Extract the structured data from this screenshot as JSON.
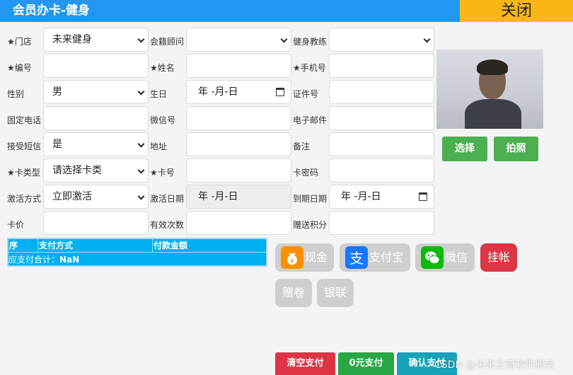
{
  "header": {
    "title": "会员办卡-健身",
    "close_label": "关闭"
  },
  "form": {
    "col1": [
      {
        "label": "★门店",
        "value": "未来健身"
      },
      {
        "label": "★编号",
        "value": ""
      },
      {
        "label": "性别",
        "value": "男"
      },
      {
        "label": "固定电话",
        "value": ""
      },
      {
        "label": "接受短信",
        "value": "是"
      },
      {
        "label": "★卡类型",
        "value": "请选择卡类"
      },
      {
        "label": "激活方式",
        "value": "立即激活"
      },
      {
        "label": "卡价",
        "value": ""
      }
    ],
    "col2": [
      {
        "label": "会籍顾问",
        "value": ""
      },
      {
        "label": "★姓名",
        "value": ""
      },
      {
        "label": "生日",
        "value": "年 -月-日"
      },
      {
        "label": "微信号",
        "value": ""
      },
      {
        "label": "地址",
        "value": ""
      },
      {
        "label": "★卡号",
        "value": ""
      },
      {
        "label": "激活日期",
        "value": "年 -月-日"
      },
      {
        "label": "有效次数",
        "value": ""
      }
    ],
    "col3": [
      {
        "label": "健身教练",
        "value": ""
      },
      {
        "label": "★手机号",
        "value": ""
      },
      {
        "label": "证件号",
        "value": ""
      },
      {
        "label": "电子邮件",
        "value": ""
      },
      {
        "label": "备注",
        "value": ""
      },
      {
        "label": "卡密码",
        "value": ""
      },
      {
        "label": "到期日期",
        "value": "年 -月-日"
      },
      {
        "label": "赠送积分",
        "value": ""
      }
    ]
  },
  "photo": {
    "select_label": "选择",
    "capture_label": "拍照"
  },
  "payment_table": {
    "columns": [
      "序",
      "支付方式",
      "付款金额"
    ],
    "total_label": "应支付合计：",
    "total_value": "NaN"
  },
  "payment_methods": [
    {
      "label": "现金",
      "icon": "cash-icon",
      "color": "#ff8f00"
    },
    {
      "label": "支付宝",
      "icon": "alipay-icon",
      "color": "#1677ff"
    },
    {
      "label": "微信",
      "icon": "wechat-icon",
      "color": "#09bb07"
    },
    {
      "label": "挂帐",
      "color": "#dc3545"
    },
    {
      "label": "赠卷"
    },
    {
      "label": "银联"
    }
  ],
  "actions": {
    "clear": "清空支付",
    "zero": "0元支付",
    "confirm": "确认支付"
  },
  "watermark": "CSDN @未来之窗软件服务"
}
